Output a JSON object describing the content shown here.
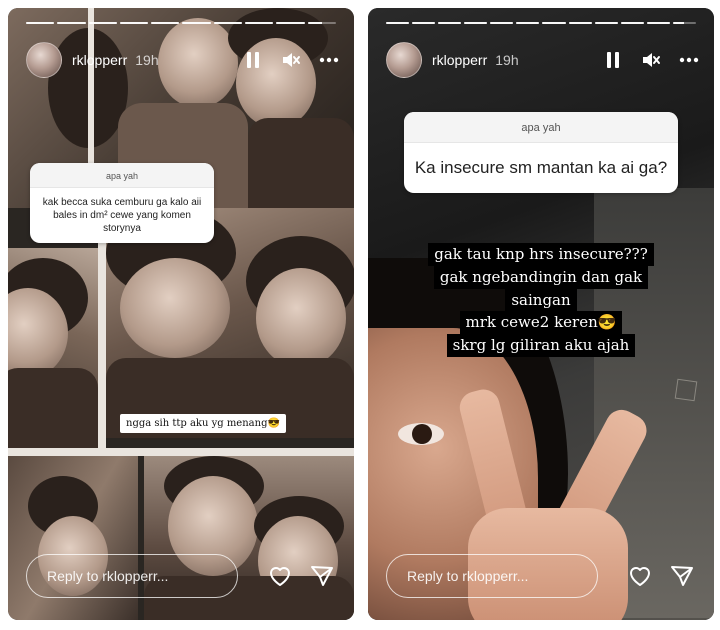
{
  "stories": [
    {
      "username": "rklopperr",
      "time": "19h",
      "question_sticker": {
        "header": "apa yah",
        "question": "kak becca suka cemburu ga kalo aii bales in dm² cewe yang komen storynya"
      },
      "caption": "ngga sih ttp aku yg menang😎",
      "reply_placeholder": "Reply to rklopperr...",
      "progress": [
        1,
        1,
        1,
        1,
        1,
        1,
        1,
        1,
        1,
        0.5
      ]
    },
    {
      "username": "rklopperr",
      "time": "19h",
      "question_sticker": {
        "header": "apa yah",
        "question": "Ka insecure sm mantan ka ai ga?"
      },
      "answer_lines": [
        "gak tau knp hrs insecure???",
        "gak ngebandingin dan gak",
        "saingan",
        "mrk cewe2 keren😎",
        "skrg lg giliran aku ajah"
      ],
      "reply_placeholder": "Reply to rklopperr...",
      "progress": [
        1,
        1,
        1,
        1,
        1,
        1,
        1,
        1,
        1,
        1,
        1,
        0.5
      ]
    }
  ],
  "icons": {
    "pause": "pause-icon",
    "mute": "mute-icon",
    "more": "more-icon",
    "like": "heart-icon",
    "send": "send-icon"
  }
}
